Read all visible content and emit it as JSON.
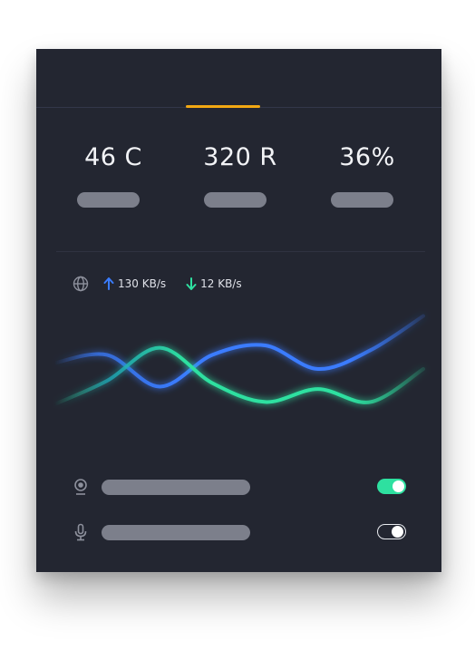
{
  "stats": [
    {
      "value": "46 C"
    },
    {
      "value": "320 R"
    },
    {
      "value": "36%"
    }
  ],
  "network": {
    "icon": "globe-icon",
    "upload": {
      "icon": "arrow-up-icon",
      "rate": "130 KB/s",
      "color": "#3a7cff"
    },
    "download": {
      "icon": "arrow-down-icon",
      "rate": "12 KB/s",
      "color": "#2ee0a0"
    }
  },
  "chart_data": {
    "type": "line",
    "title": "",
    "xlabel": "",
    "ylabel": "",
    "grid": false,
    "series": [
      {
        "color": "#3a7cff",
        "values": [
          0.55,
          0.62,
          0.35,
          0.62,
          0.7,
          0.5,
          0.66,
          0.95
        ]
      },
      {
        "color": "#2ee0a0",
        "values": [
          0.2,
          0.4,
          0.68,
          0.38,
          0.22,
          0.33,
          0.22,
          0.5
        ]
      }
    ]
  },
  "toggles": [
    {
      "icon": "webcam-icon",
      "state": "on"
    },
    {
      "icon": "microphone-icon",
      "state": "off"
    }
  ],
  "colors": {
    "accent": "#f2a813",
    "background": "#232631",
    "placeholder": "#7c7f8b",
    "toggle_on": "#2ee0a0"
  }
}
